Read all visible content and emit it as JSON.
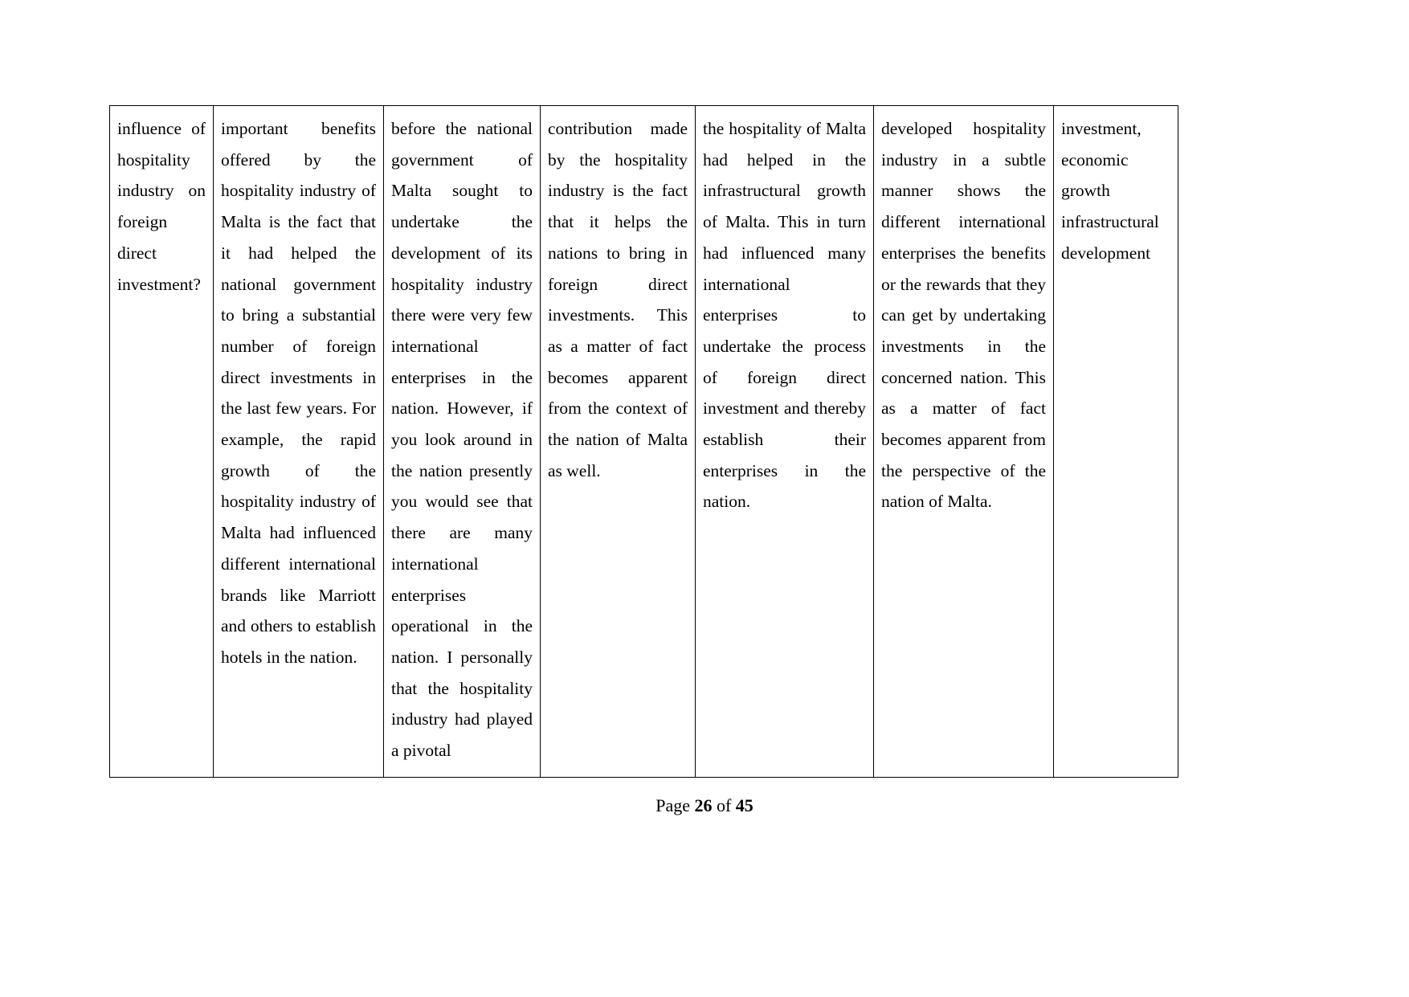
{
  "document": {
    "page_background": "#ffffff",
    "text_color": "#000000",
    "border_color": "#000000"
  },
  "table": {
    "columns": 7,
    "cells": [
      "influence of hospitality industry on foreign direct investment?",
      "important benefits offered by the hospitality industry of Malta is the fact that it had helped the national government to bring a substantial number of foreign direct investments in the last few years. For example, the rapid growth of the hospitality industry of Malta had influenced different international brands like Marriott and others to establish hotels in the nation.",
      "before the national government of Malta sought to undertake the development of its hospitality industry there were very few international enterprises in the nation. However, if you look around in the nation presently you would see that there are many international enterprises operational in the nation. I personally that the hospitality industry had played a pivotal",
      "contribution made by the hospitality industry is the fact that it helps the nations to bring in foreign direct investments. This as a matter of fact becomes apparent from the context of the nation of Malta as well.",
      "the hospitality of Malta had helped in the infrastructural growth of Malta. This in turn had influenced many international enterprises to undertake the process of foreign direct investment and thereby establish their enterprises in the nation.",
      "developed hospitality industry in a subtle manner shows the different international enterprises the benefits or the rewards that they can get by undertaking investments in the concerned nation. This as a matter of fact becomes apparent from the perspective of the nation of Malta.",
      "investment, economic growth infrastructural development"
    ]
  },
  "footer": {
    "prefix": "Page ",
    "current_page": "26",
    "middle": " of ",
    "total_pages": "45"
  }
}
